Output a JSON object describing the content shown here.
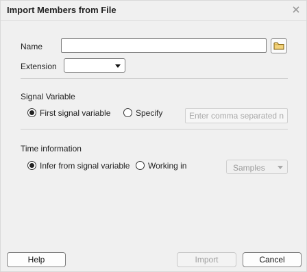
{
  "dialog": {
    "title": "Import Members from File",
    "close_icon": "close-icon"
  },
  "file": {
    "name_label": "Name",
    "name_value": "",
    "browse_icon": "folder-icon",
    "extension_label": "Extension",
    "extension_value": ""
  },
  "signal_variable": {
    "section_label": "Signal Variable",
    "option_first": "First signal variable",
    "option_specify": "Specify",
    "selected": "First signal variable",
    "specify_placeholder": "Enter comma separated na"
  },
  "time_information": {
    "section_label": "Time information",
    "option_infer": "Infer from signal variable",
    "option_working": "Working in",
    "selected": "Infer from signal variable",
    "units_value": "Samples"
  },
  "footer": {
    "help_label": "Help",
    "import_label": "Import",
    "cancel_label": "Cancel"
  }
}
